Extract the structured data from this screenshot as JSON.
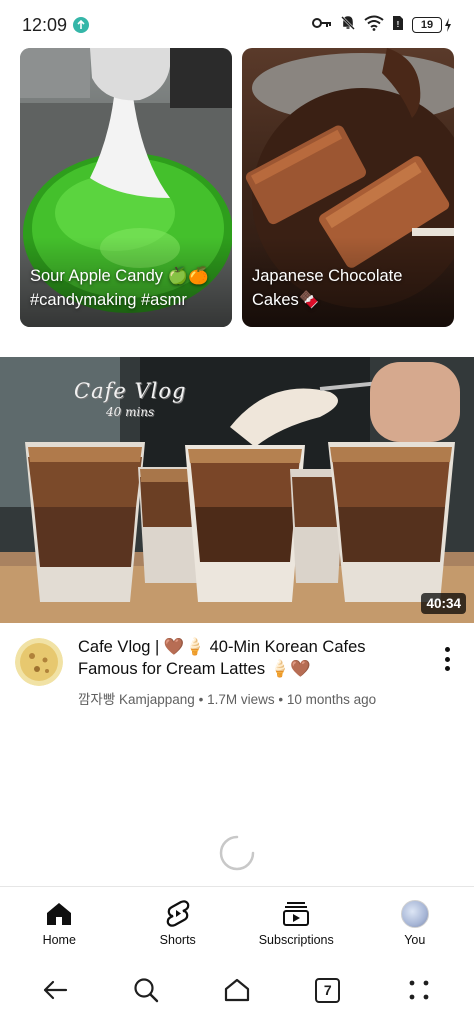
{
  "status_bar": {
    "time": "12:09",
    "battery": "19",
    "icons": [
      "key-icon",
      "bell-muted-icon",
      "wifi-icon",
      "sim-icon",
      "battery-icon",
      "charging-icon"
    ]
  },
  "shorts": [
    {
      "title": "Sour Apple Candy 🍏🍊 #candymaking #asmr"
    },
    {
      "title": "Japanese Chocolate Cakes🍫"
    }
  ],
  "video": {
    "thumbnail_title": "Cafe Vlog",
    "thumbnail_subtitle": "40 mins",
    "duration": "40:34",
    "title": "Cafe Vlog | 🤎🍦 40-Min Korean Cafes Famous for Cream Lattes 🍦🤎",
    "channel": "깜자빵 Kamjappang",
    "views": "1.7M views",
    "age": "10 months ago",
    "separator": " • "
  },
  "bottom_nav": {
    "items": [
      {
        "label": "Home",
        "icon": "home-icon"
      },
      {
        "label": "Shorts",
        "icon": "shorts-icon"
      },
      {
        "label": "Subscriptions",
        "icon": "subscriptions-icon"
      },
      {
        "label": "You",
        "icon": "avatar"
      }
    ]
  },
  "system_nav": {
    "tab_count": "7",
    "icons": [
      "back-icon",
      "search-icon",
      "home-icon",
      "tabs-icon",
      "menu-icon"
    ]
  },
  "colors": {
    "candy_green": "#3fbf2a",
    "chocolate": "#7a4427",
    "text_primary": "#0f0f0f",
    "text_secondary": "#606060"
  }
}
